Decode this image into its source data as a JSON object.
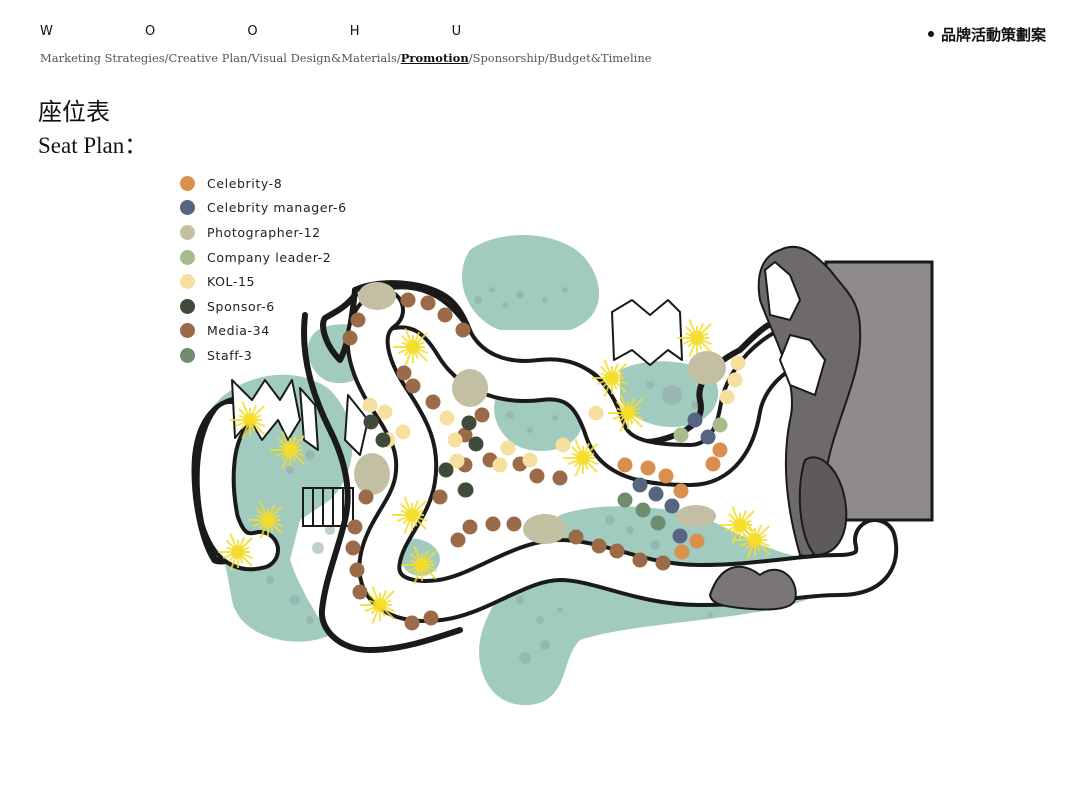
{
  "header": {
    "brand": "W O O H U",
    "nav": [
      {
        "label": "Marketing Strategies",
        "active": false
      },
      {
        "label": "Creative Plan",
        "active": false
      },
      {
        "label": "Visual Design&Materials",
        "active": false
      },
      {
        "label": "Promotion",
        "active": true
      },
      {
        "label": "Sponsorship",
        "active": false
      },
      {
        "label": "Budget&Timeline",
        "active": false
      }
    ],
    "nav_separator": "/",
    "category_tag": "品牌活動策劃案"
  },
  "page": {
    "title_cn": "座位表",
    "title_en": "Seat Plan："
  },
  "legend": [
    {
      "label": "Celebrity-8",
      "color": "#d98f4e"
    },
    {
      "label": "Celebrity manager-6",
      "color": "#566580"
    },
    {
      "label": "Photographer-12",
      "color": "#c2bfa2"
    },
    {
      "label": "Company leader-2",
      "color": "#a8bb8c"
    },
    {
      "label": "KOL-15",
      "color": "#f5e0a0"
    },
    {
      "label": "Sponsor-6",
      "color": "#3f4a3c"
    },
    {
      "label": "Media-34",
      "color": "#9b6a49"
    },
    {
      "label": "Staff-3",
      "color": "#6f8c6e"
    }
  ],
  "colors": {
    "pond": "#a2cbc0",
    "path_outline": "#111111",
    "rock": "#8f8b8b",
    "light": "#f5dd2a"
  }
}
